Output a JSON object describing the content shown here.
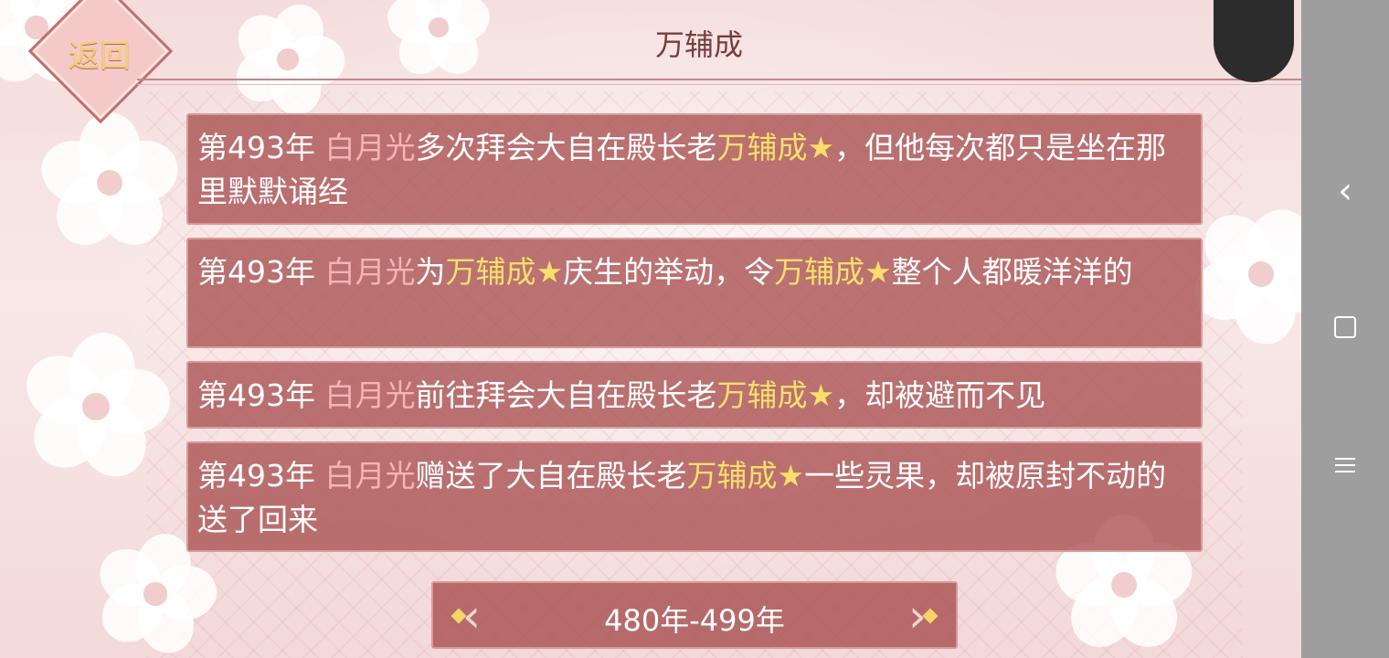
{
  "header": {
    "back_label": "返回",
    "title": "万辅成"
  },
  "entries": [
    {
      "year": "第493年",
      "segments": [
        {
          "text": "白月光",
          "style": "pink"
        },
        {
          "text": "多次拜会大自在殿长老",
          "style": "normal"
        },
        {
          "text": "万辅成★",
          "style": "gold"
        },
        {
          "text": "，但他每次都只是坐在那里默默诵经",
          "style": "normal"
        }
      ]
    },
    {
      "year": "第493年",
      "segments": [
        {
          "text": "白月光",
          "style": "pink"
        },
        {
          "text": "为",
          "style": "normal"
        },
        {
          "text": "万辅成★",
          "style": "gold"
        },
        {
          "text": "庆生的举动，令",
          "style": "normal"
        },
        {
          "text": "万辅成★",
          "style": "gold"
        },
        {
          "text": "整个人都暖洋洋的",
          "style": "normal"
        }
      ]
    },
    {
      "year": "第493年",
      "segments": [
        {
          "text": "白月光",
          "style": "pink"
        },
        {
          "text": "前往拜会大自在殿长老",
          "style": "normal"
        },
        {
          "text": "万辅成★",
          "style": "gold"
        },
        {
          "text": "，却被避而不见",
          "style": "normal"
        }
      ]
    },
    {
      "year": "第493年",
      "segments": [
        {
          "text": "白月光",
          "style": "pink"
        },
        {
          "text": "赠送了大自在殿长老",
          "style": "normal"
        },
        {
          "text": "万辅成★",
          "style": "gold"
        },
        {
          "text": "一些灵果，却被原封不动的送了回来",
          "style": "normal"
        }
      ]
    }
  ],
  "pager": {
    "label": "480年-499年",
    "prev_icon": "chevron-left-icon",
    "next_icon": "chevron-right-icon"
  },
  "system_nav": {
    "back_icon": "back-icon",
    "home_icon": "home-icon",
    "menu_icon": "menu-icon"
  },
  "colors": {
    "entry_bg": "#ac5656",
    "highlight_pink": "#f5b4b4",
    "highlight_gold": "#f8de6a",
    "title": "#7a3c3c",
    "back_label": "#f2cf73"
  }
}
